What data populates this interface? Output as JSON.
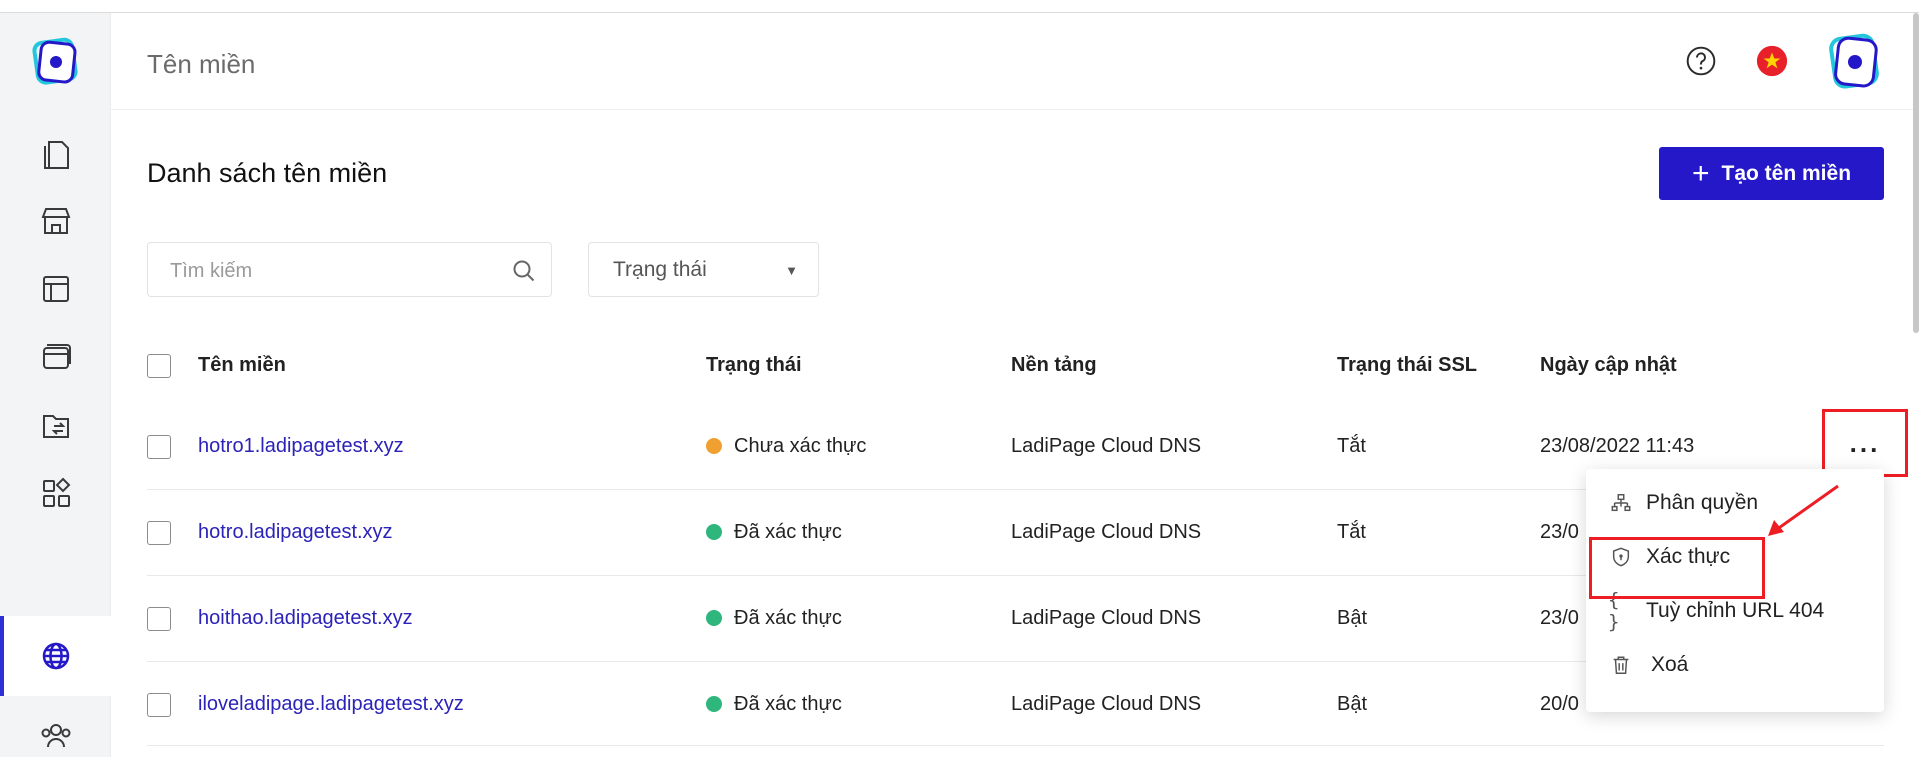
{
  "app": {
    "page_title": "Tên miền"
  },
  "sidebar": {
    "items": [
      {
        "name": "pages",
        "icon": "pages-icon"
      },
      {
        "name": "store",
        "icon": "store-icon"
      },
      {
        "name": "templates",
        "icon": "layout-icon"
      },
      {
        "name": "browser",
        "icon": "browser-icon"
      },
      {
        "name": "files",
        "icon": "folder-transfer-icon"
      },
      {
        "name": "apps",
        "icon": "apps-icon"
      },
      {
        "name": "domains",
        "icon": "globe-icon",
        "active": true
      },
      {
        "name": "users",
        "icon": "users-icon"
      }
    ]
  },
  "header": {
    "help_icon": "help-icon",
    "language_icon": "vietnam-flag-icon"
  },
  "main": {
    "section_title": "Danh sách tên miền",
    "create_button": "Tạo tên miền",
    "search": {
      "placeholder": "Tìm kiếm"
    },
    "status_filter": {
      "label": "Trạng thái"
    }
  },
  "table": {
    "columns": [
      "Tên miền",
      "Trạng thái",
      "Nền tảng",
      "Trạng thái SSL",
      "Ngày cập nhật"
    ],
    "rows": [
      {
        "domain": "hotro1.ladipagetest.xyz",
        "status": "Chưa xác thực",
        "status_color": "#f0a030",
        "platform": "LadiPage Cloud DNS",
        "ssl": "Tắt",
        "updated": "23/08/2022 11:43"
      },
      {
        "domain": "hotro.ladipagetest.xyz",
        "status": "Đã xác thực",
        "status_color": "#2eb67d",
        "platform": "LadiPage Cloud DNS",
        "ssl": "Tắt",
        "updated": "23/0"
      },
      {
        "domain": "hoithao.ladipagetest.xyz",
        "status": "Đã xác thực",
        "status_color": "#2eb67d",
        "platform": "LadiPage Cloud DNS",
        "ssl": "Bật",
        "updated": "23/0"
      },
      {
        "domain": "iloveladipage.ladipagetest.xyz",
        "status": "Đã xác thực",
        "status_color": "#2eb67d",
        "platform": "LadiPage Cloud DNS",
        "ssl": "Bật",
        "updated": "20/0"
      }
    ]
  },
  "more_menu": {
    "trigger": "...",
    "items": [
      {
        "label": "Phân quyền",
        "icon": "sitemap-icon"
      },
      {
        "label": "Xác thực",
        "icon": "shield-icon"
      },
      {
        "label": "Tuỳ chỉnh URL 404",
        "icon": "braces-icon"
      },
      {
        "label": "Xoá",
        "icon": "trash-icon"
      }
    ]
  },
  "colors": {
    "accent": "#2418c8",
    "link": "#2b22b8",
    "annotation_red": "#ee1d24"
  }
}
